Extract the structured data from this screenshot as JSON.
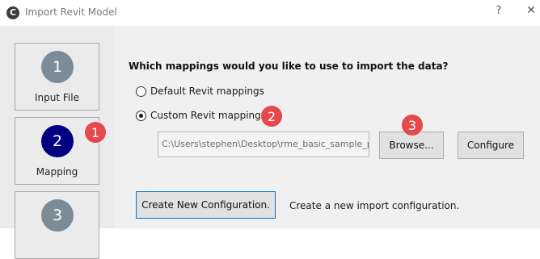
{
  "window": {
    "title": "Import Revit Model",
    "app_icon_glyph": "C",
    "help_glyph": "?",
    "close_glyph": "✕"
  },
  "steps": [
    {
      "number": "1",
      "label": "Input File",
      "state": "completed"
    },
    {
      "number": "2",
      "label": "Mapping",
      "state": "active"
    },
    {
      "number": "3",
      "label": "",
      "state": "pending"
    }
  ],
  "mapping": {
    "question": "Which mappings would you like to use to import the data?",
    "options": [
      {
        "label": "Default Revit mappings",
        "selected": false
      },
      {
        "label": "Custom Revit mappings",
        "selected": true
      }
    ],
    "file_path": "C:\\Users\\stephen\\Desktop\\rme_basic_sample_pro",
    "browse_label": "Browse...",
    "configure_label": "Configure"
  },
  "create_config": {
    "button_label": "Create New Configuration.",
    "description": "Create a new import configuration."
  },
  "callouts": [
    "1",
    "2",
    "3"
  ],
  "colors": {
    "step_active": "#000080",
    "step_pending": "#7b8b97",
    "callout": "#e5484d",
    "focus_border": "#0078d7"
  }
}
